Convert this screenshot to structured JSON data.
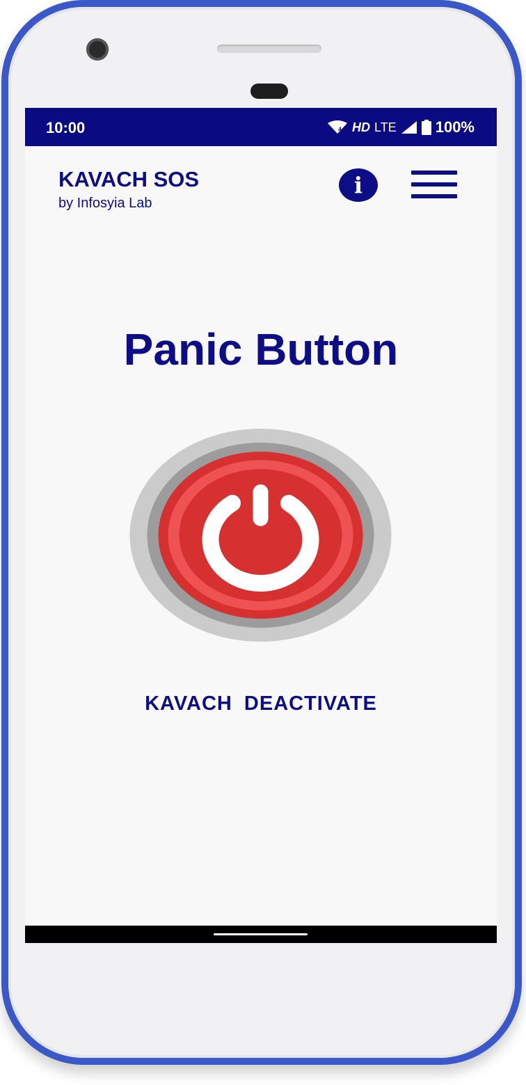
{
  "status_bar": {
    "time": "10:00",
    "network": "HD",
    "network_type": "LTE",
    "battery": "100%",
    "icons": [
      "wifi-icon",
      "signal-icon",
      "battery-icon"
    ]
  },
  "header": {
    "title": "KAVACH SOS",
    "subtitle": "by Infosyia Lab",
    "info_icon": "info-icon",
    "info_glyph": "i",
    "menu_icon": "hamburger-menu-icon"
  },
  "main": {
    "heading": "Panic Button",
    "panic_icon": "power-icon",
    "action_label": "KAVACH  DEACTIVATE"
  },
  "colors": {
    "brand": "#0d0d86",
    "status_bar": "#0a0a82",
    "panic_red": "#d63030",
    "panic_ring": "#ef5252"
  }
}
